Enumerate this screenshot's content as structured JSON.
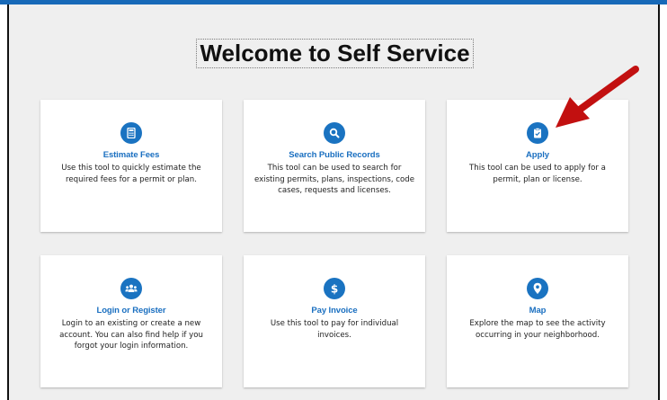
{
  "header": {
    "title": "Welcome to Self Service"
  },
  "cards": [
    {
      "icon": "calculator-icon",
      "title": "Estimate Fees",
      "description": "Use this tool to quickly estimate the required fees for a permit or plan."
    },
    {
      "icon": "search-icon",
      "title": "Search Public Records",
      "description": "This tool can be used to search for existing permits, plans, inspections, code cases, requests and licenses."
    },
    {
      "icon": "clipboard-check-icon",
      "title": "Apply",
      "description": "This tool can be used to apply for a permit, plan or license."
    },
    {
      "icon": "users-icon",
      "title": "Login or Register",
      "description": "Login to an existing or create a new account. You can also find help if you forgot your login information."
    },
    {
      "icon": "dollar-icon",
      "title": "Pay Invoice",
      "description": "Use this tool to pay for individual invoices."
    },
    {
      "icon": "map-pin-icon",
      "title": "Map",
      "description": "Explore the map to see the activity occurring in your neighborhood."
    }
  ],
  "colors": {
    "accent": "#1a73c1",
    "title_text": "#1a6fc0",
    "top_bar": "#1769b8",
    "background": "#efefef",
    "annotation_arrow": "#c21010"
  }
}
